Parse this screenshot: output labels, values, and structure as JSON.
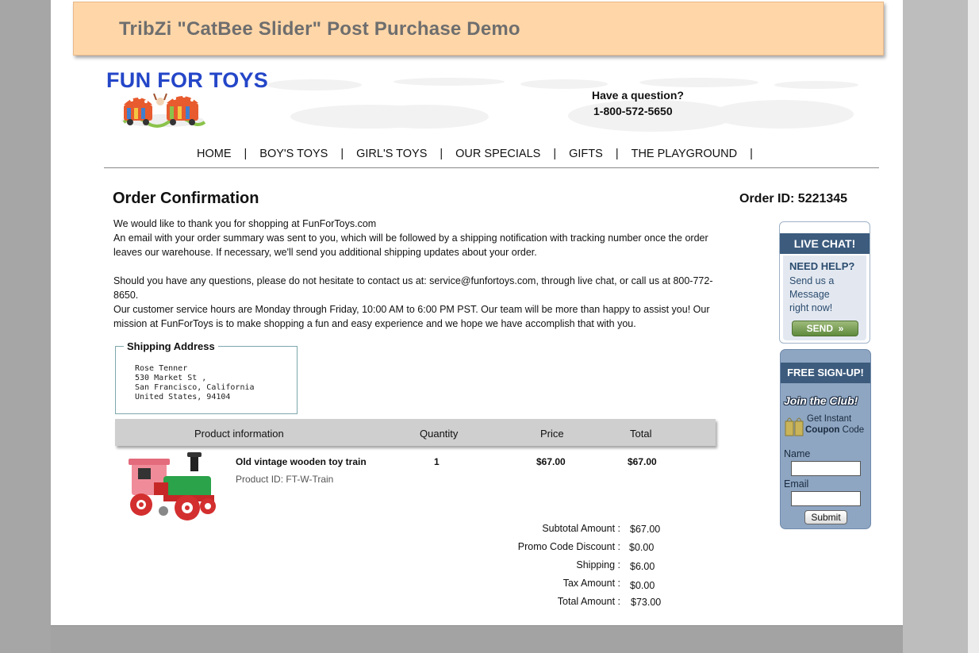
{
  "demo_banner": {
    "title": "TribZi \"CatBee Slider\" Post Purchase Demo"
  },
  "header": {
    "logo_text": "FUN FOR TOYS",
    "question": "Have a question?",
    "phone": "1-800-572-5650"
  },
  "nav": {
    "items": [
      {
        "label": "HOME"
      },
      {
        "label": "BOY'S TOYS"
      },
      {
        "label": "GIRL'S TOYS"
      },
      {
        "label": "OUR SPECIALS"
      },
      {
        "label": "GIFTS"
      },
      {
        "label": "THE PLAYGROUND"
      }
    ],
    "separator": "|"
  },
  "order": {
    "title": "Order Confirmation",
    "id_label": "Order ID: 5221345",
    "paragraph1": [
      "We would like to thank you for shopping at FunForToys.com",
      "An email with your order summary was sent to you, which will be followed by a shipping notification with tracking number once the order",
      "leaves our warehouse. If necessary, we'll send you additional shipping updates about your order."
    ],
    "paragraph2": [
      "Should you have any questions, please do not hesitate to contact us at: service@funfortoys.com, through live chat, or call us at 800-772-8650.",
      "Our customer service hours are Monday through Friday, 10:00 AM to 6:00 PM PST. Our team will be more than happy to assist you! Our",
      "mission at FunForToys is to make shopping a fun  and easy experience and we hope we have accomplish that with you."
    ]
  },
  "shipping": {
    "legend": "Shipping Address",
    "lines": [
      "Rose Tenner",
      "530 Market St ,",
      "San Francisco, California",
      "United States, 94104"
    ]
  },
  "table": {
    "headers": {
      "product": "Product information",
      "quantity": "Quantity",
      "price": "Price",
      "total": "Total"
    },
    "rows": [
      {
        "name": "Old vintage wooden toy train",
        "product_id": "Product ID: FT-W-Train",
        "quantity": "1",
        "price": "$67.00",
        "total": "$67.00"
      }
    ]
  },
  "summary": [
    {
      "label": "Subtotal Amount :",
      "value": "$67.00"
    },
    {
      "label": "Promo Code Discount :",
      "value": "$0.00"
    },
    {
      "label": "Shipping :",
      "value": "$6.00"
    },
    {
      "label": "Tax Amount :",
      "value": "$0.00"
    },
    {
      "label": "Total Amount :",
      "value": "$73.00"
    }
  ],
  "live_chat": {
    "header": "LIVE CHAT!",
    "need_help": "NEED HELP?",
    "message": [
      "Send us a",
      "Message",
      "right now!"
    ],
    "send_label": "SEND"
  },
  "signup": {
    "header": "FREE SIGN-UP!",
    "join": "Join the Club!",
    "coupon_line1": "Get Instant",
    "coupon_bold": "Coupon",
    "coupon_rest": "Code",
    "name_label": "Name",
    "email_label": "Email",
    "submit_label": "Submit"
  },
  "colors": {
    "banner_bg": "#ffd6a8",
    "logo_blue": "#2446c8",
    "sidebar_navy": "#3c5b7d",
    "signup_bg": "#8ea6c2",
    "send_green": "#5f8a3c"
  }
}
